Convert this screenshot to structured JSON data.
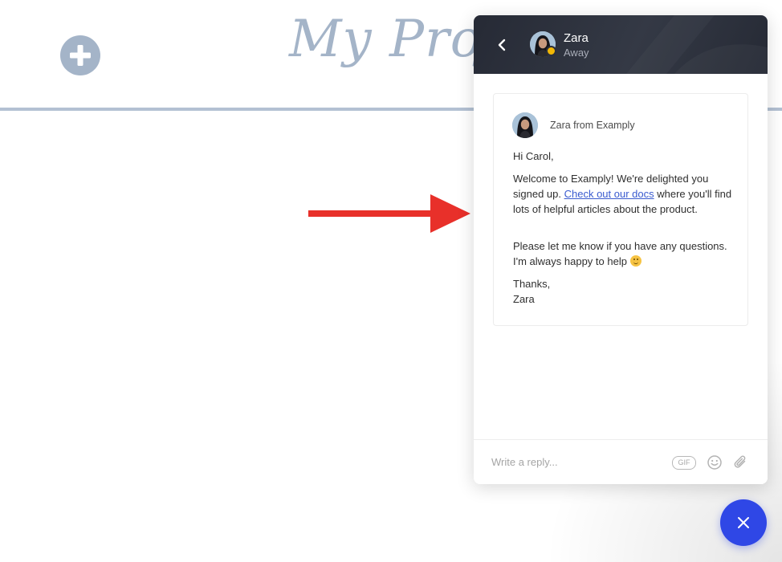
{
  "app": {
    "title": "My Project",
    "add_icon": "plus-circle-icon"
  },
  "annotation": {
    "arrow_color": "#e8302a",
    "arrow_icon": "arrow-right-icon"
  },
  "chat": {
    "header": {
      "agent_name": "Zara",
      "agent_status": "Away",
      "status_color": "#f2b705",
      "back_icon": "chevron-left-icon"
    },
    "message": {
      "sender": "Zara from Examply",
      "greeting": "Hi Carol,",
      "p1_before_link": "Welcome to Examply! We're delighted you signed up. ",
      "p1_link": "Check out our docs",
      "p1_after_link": " where you'll find lots of helpful articles about the product.",
      "p2": "Please let me know if you have any questions. I'm always happy to help ",
      "p2_emoji": "smiling-face-icon",
      "signoff": "Thanks,",
      "signature": "Zara"
    },
    "composer": {
      "placeholder": "Write a reply...",
      "gif_label": "GIF",
      "emoji_icon": "smiley-icon",
      "attach_icon": "paperclip-icon"
    },
    "launcher": {
      "close_icon": "close-icon",
      "color": "#2f47e6"
    }
  }
}
